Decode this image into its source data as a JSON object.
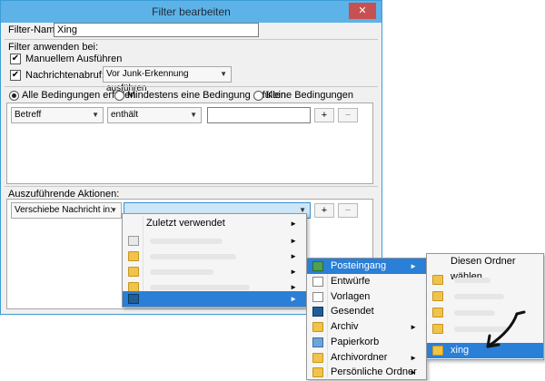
{
  "window": {
    "title": "Filter bearbeiten",
    "close_label": "✕"
  },
  "filter_name": {
    "label": "Filter-Name:",
    "value": "Xing"
  },
  "apply_section": {
    "label": "Filter anwenden bei:",
    "manual": {
      "label": "Manuellem Ausführen",
      "checked": true
    },
    "fetch": {
      "label": "Nachrichtenabruf:",
      "checked": true
    },
    "fetch_mode": "Vor Junk-Erkennung ausführen"
  },
  "match": {
    "all": "Alle Bedingungen erfüllen",
    "any": "Mindestens eine Bedingung erfüllen",
    "none": "Keine Bedingungen",
    "selected": "all"
  },
  "condition": {
    "field": "Betreff",
    "operator": "enthält",
    "value": "",
    "add": "+",
    "remove": "−"
  },
  "actions": {
    "label": "Auszuführende Aktionen:",
    "action": "Verschiebe Nachricht in:",
    "target": "",
    "add": "+",
    "remove": "−"
  },
  "menu1": {
    "items": [
      {
        "label": "Zuletzt verwendet",
        "icon": "none",
        "submenu": true
      }
    ]
  },
  "menu2": {
    "items": [
      {
        "label": "Posteingang",
        "icon": "inbox-icon",
        "submenu": true
      },
      {
        "label": "Entwürfe",
        "icon": "drafts-icon",
        "submenu": false
      },
      {
        "label": "Vorlagen",
        "icon": "templates-icon",
        "submenu": false
      },
      {
        "label": "Gesendet",
        "icon": "sent-icon",
        "submenu": false
      },
      {
        "label": "Archiv",
        "icon": "folder-icon",
        "submenu": true
      },
      {
        "label": "Papierkorb",
        "icon": "trash-icon",
        "submenu": false
      },
      {
        "label": "Archivordner",
        "icon": "folder-icon",
        "submenu": true
      },
      {
        "label": "Persönliche Ordner",
        "icon": "folder-icon",
        "submenu": true
      }
    ]
  },
  "menu3": {
    "header": "Diesen Ordner wählen",
    "selected": "xing"
  },
  "colors": {
    "titlebar": "#5db2e8",
    "highlight": "#2a7fd6",
    "close": "#c75050"
  }
}
